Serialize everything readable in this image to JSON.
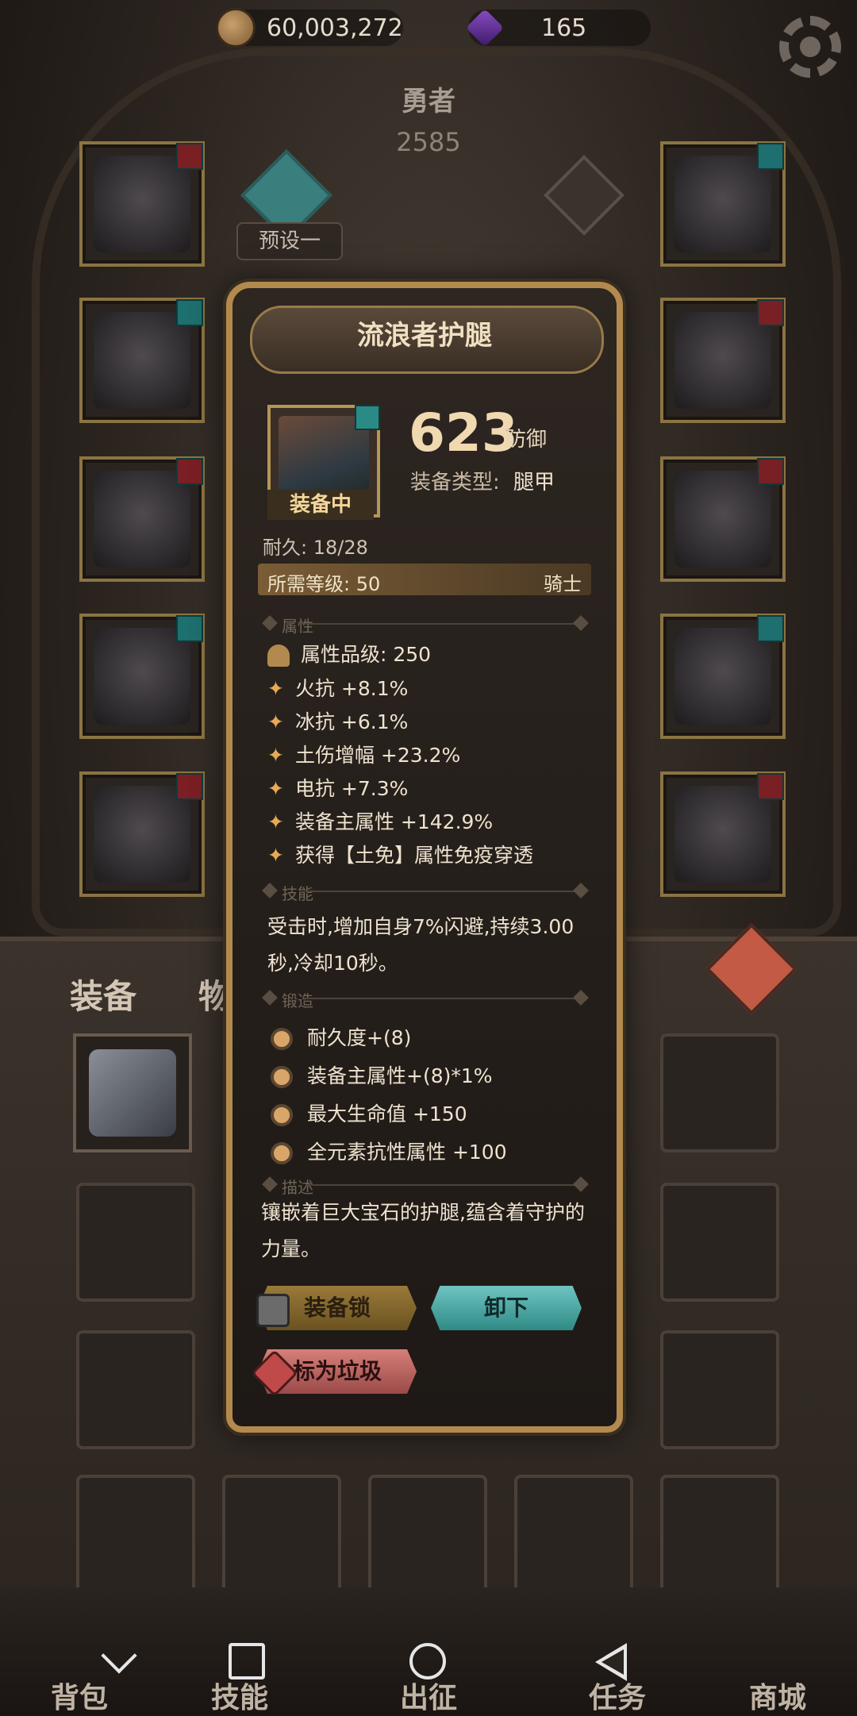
{
  "resources": {
    "gold": "60,003,272",
    "gems": "165"
  },
  "hero": {
    "name": "勇者",
    "power": "2585",
    "preset": "预设一"
  },
  "tabs": {
    "equipment": "装备",
    "items": "物品"
  },
  "nav": {
    "bag": "背包",
    "skills": "技能",
    "expedition": "出征",
    "quests": "任务",
    "shop": "商城"
  },
  "item": {
    "name": "流浪者护腿",
    "status": "装备中",
    "defense_value": "623",
    "defense_label": "防御",
    "type_label": "装备类型:",
    "type_value": "腿甲",
    "durability": "耐久: 18/28",
    "required_level": "所需等级: 50",
    "class": "骑士",
    "sections": {
      "attributes": "属性",
      "skills": "技能",
      "forge": "锻造",
      "description": "描述"
    },
    "quality": "属性品级: 250",
    "properties": [
      "火抗 +8.1%",
      "冰抗 +6.1%",
      "土伤增幅 +23.2%",
      "电抗 +7.3%",
      "装备主属性 +142.9%",
      "获得【土免】属性免疫穿透"
    ],
    "skill": "受击时,增加自身7%闪避,持续3.00秒,冷却10秒。",
    "forge": [
      "耐久度+(8)",
      "装备主属性+(8)*1%",
      "最大生命值 +150",
      "全元素抗性属性 +100"
    ],
    "description": "镶嵌着巨大宝石的护腿,蕴含着守护的力量。",
    "buttons": {
      "lock": "装备锁",
      "unequip": "卸下",
      "trash": "标为垃圾"
    }
  },
  "colors": {
    "accent_gold": "#b38a4d",
    "unequip_teal": "#2f8a86",
    "trash_red": "#9a4a48"
  }
}
